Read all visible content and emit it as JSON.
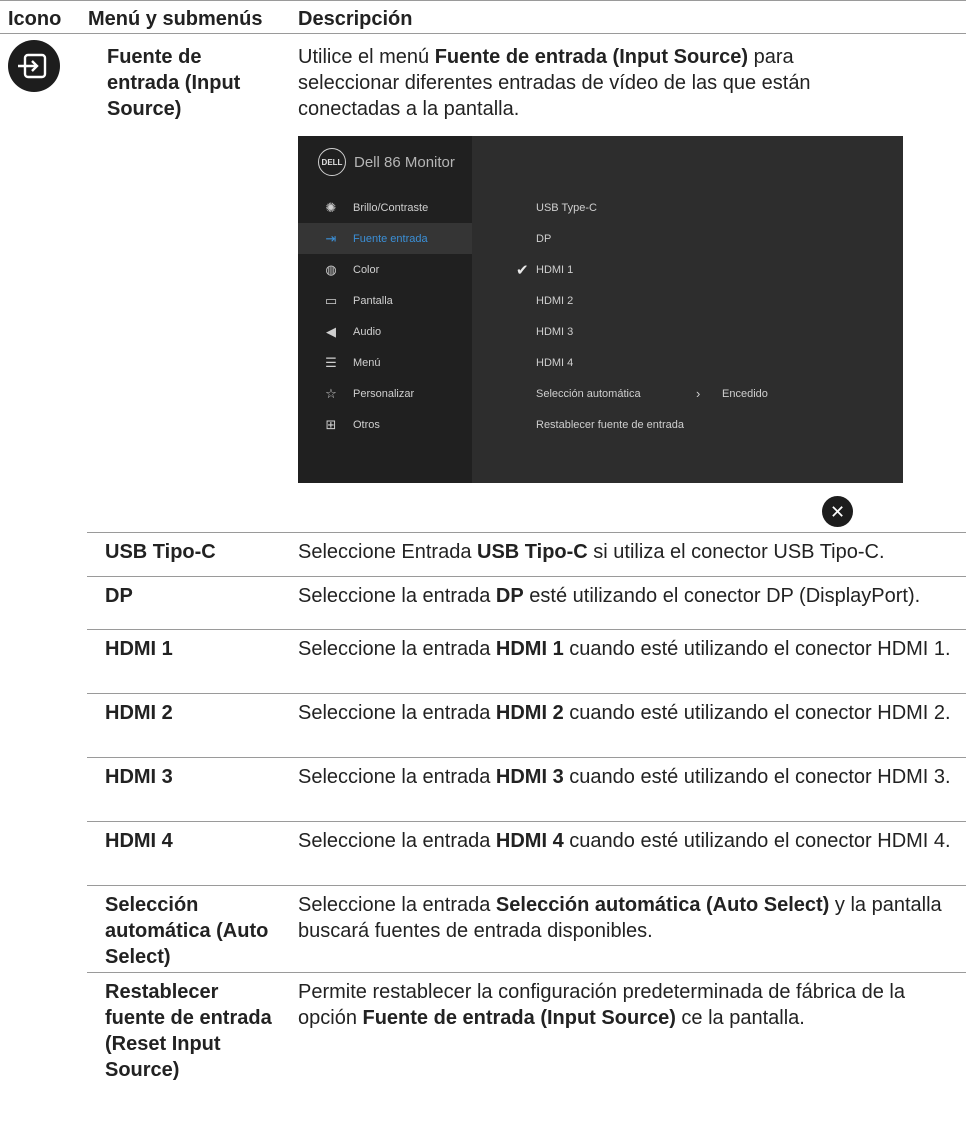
{
  "header": {
    "col_icon": "Icono",
    "col_menu": "Menú y submenús",
    "col_desc": "Descripción"
  },
  "section": {
    "icon": "input-source-icon",
    "title": "Fuente de entrada (Input Source)",
    "intro_pre": "Utilice el menú ",
    "intro_bold": "Fuente de entrada (Input Source)",
    "intro_post": " para seleccionar diferentes entradas de vídeo de las que están conectadas a la pantalla."
  },
  "osd": {
    "title": "Dell 86 Monitor",
    "logo_text": "DELL",
    "accent": "#3b8fd6",
    "nav": [
      {
        "label": "Brillo/Contraste",
        "icon": "sun-icon",
        "active": false
      },
      {
        "label": "Fuente entrada",
        "icon": "input-icon",
        "active": true
      },
      {
        "label": "Color",
        "icon": "palette-icon",
        "active": false
      },
      {
        "label": "Pantalla",
        "icon": "monitor-icon",
        "active": false
      },
      {
        "label": "Audio",
        "icon": "speaker-icon",
        "active": false
      },
      {
        "label": "Menú",
        "icon": "menu-icon",
        "active": false
      },
      {
        "label": "Personalizar",
        "icon": "star-icon",
        "active": false
      },
      {
        "label": "Otros",
        "icon": "sliders-icon",
        "active": false
      }
    ],
    "options": [
      {
        "label": "USB Type-C"
      },
      {
        "label": "DP"
      },
      {
        "label": "HDMI 1",
        "checked": true
      },
      {
        "label": "HDMI 2"
      },
      {
        "label": "HDMI 3"
      },
      {
        "label": "HDMI 4"
      },
      {
        "label": "Selección automática",
        "arrow": "›",
        "value": "Encedido"
      },
      {
        "label": "Restablecer fuente de entrada"
      }
    ],
    "close_icon": "close-icon"
  },
  "table": {
    "rows": [
      {
        "name": "USB Tipo-C",
        "pre": "Seleccione Entrada ",
        "bold": "USB Tipo-C",
        "post": " si utiliza el conector USB Tipo-C."
      },
      {
        "name": "DP",
        "pre": "Seleccione la entrada ",
        "bold": "DP",
        "post": " esté utilizando el conector DP (DisplayPort)."
      },
      {
        "name": "HDMI 1",
        "pre": "Seleccione la entrada ",
        "bold": "HDMI 1",
        "post": " cuando esté utilizando el conector HDMI 1."
      },
      {
        "name": "HDMI 2",
        "pre": "Seleccione la entrada ",
        "bold": "HDMI 2",
        "post": " cuando esté utilizando el conector HDMI 2."
      },
      {
        "name": "HDMI 3",
        "pre": "Seleccione la entrada ",
        "bold": "HDMI 3",
        "post": " cuando esté utilizando el conector HDMI 3."
      },
      {
        "name": "HDMI 4",
        "pre": "Seleccione la entrada ",
        "bold": "HDMI 4",
        "post": " cuando esté utilizando el conector HDMI 4."
      },
      {
        "name": "Selección automática (Auto Select)",
        "pre": "Seleccione la entrada ",
        "bold": "Selección automática (Auto Select)",
        "post": " y la pantalla buscará fuentes de entrada disponibles."
      },
      {
        "name": "Restablecer fuente de entrada (Reset Input Source)",
        "pre": "Permite restablecer la configuración predeterminada de fábrica de la opción ",
        "bold": "Fuente de entrada (Input Source)",
        "post": " ce la pantalla."
      }
    ]
  }
}
